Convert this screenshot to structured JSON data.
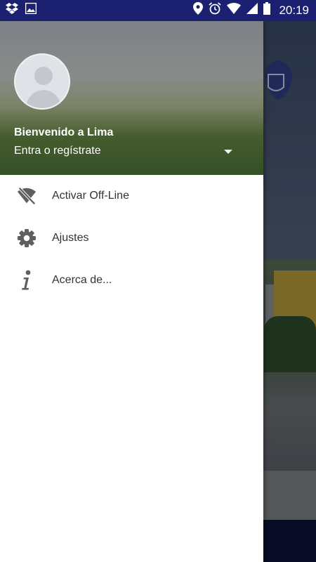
{
  "status_bar": {
    "time": "20:19",
    "icons": [
      "dropbox-icon",
      "image-icon",
      "location-icon",
      "alarm-icon",
      "wifi-icon",
      "signal-icon",
      "battery-icon"
    ]
  },
  "drawer": {
    "header": {
      "title": "Bienvenido a Lima",
      "subtitle": "Entra o regístrate",
      "avatar_icon": "person-placeholder-icon",
      "dropdown_icon": "arrow-drop-down-icon"
    },
    "items": [
      {
        "label": "Activar Off-Line",
        "icon": "wifi-off-icon"
      },
      {
        "label": "Ajustes",
        "icon": "settings-gear-icon"
      },
      {
        "label": "Acerca de...",
        "icon": "info-icon"
      }
    ]
  },
  "colors": {
    "status_bar": "#1b2170",
    "drawer_bg": "#ffffff",
    "menu_text": "#333333",
    "icon_gray": "#5f5f5f",
    "bottom_bar": "#0c1236"
  }
}
